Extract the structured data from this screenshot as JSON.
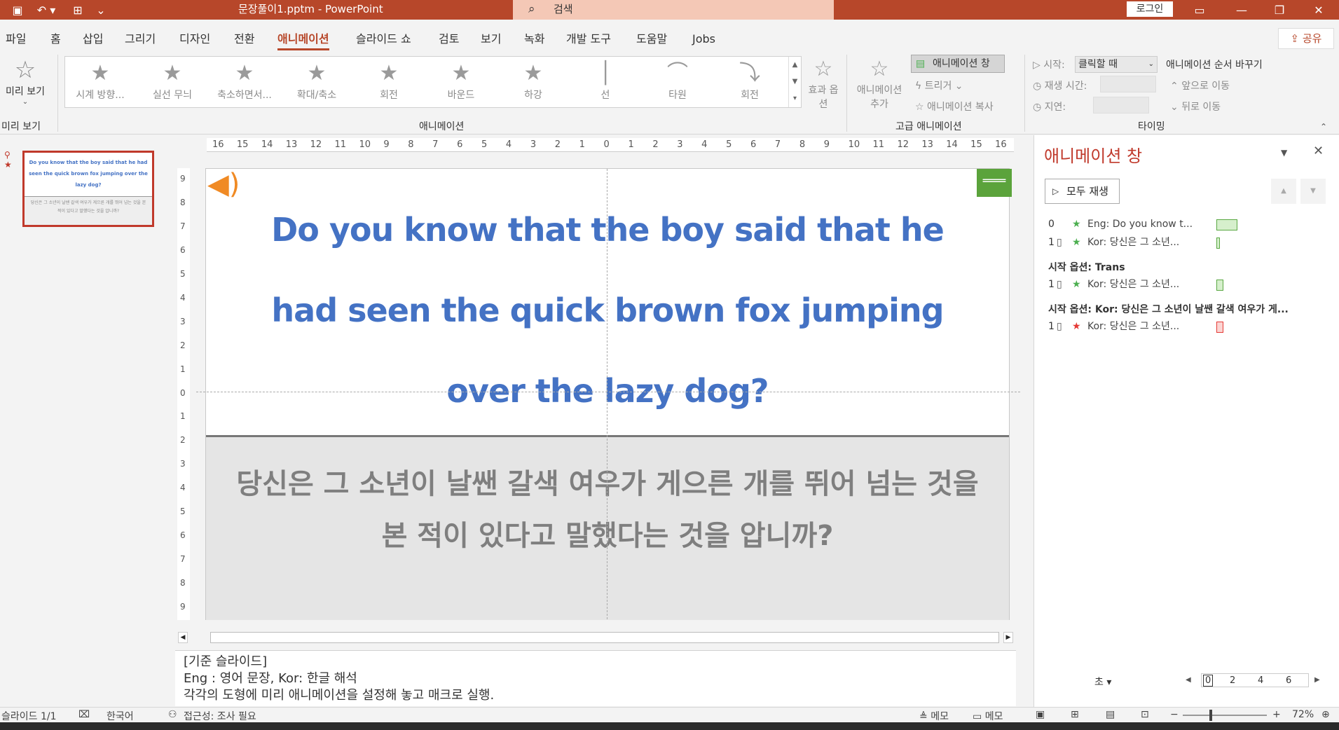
{
  "titlebar": {
    "doc_title": "문장풀이1.pptm  -  PowerPoint",
    "search_placeholder": "검색",
    "login": "로그인"
  },
  "tabs": [
    "파일",
    "홈",
    "삽입",
    "그리기",
    "디자인",
    "전환",
    "애니메이션",
    "슬라이드 쇼",
    "검토",
    "보기",
    "녹화",
    "개발 도구",
    "도움말",
    "Jobs"
  ],
  "active_tab": "애니메이션",
  "share": "공유",
  "ribbon": {
    "preview_label": "미리 보기",
    "preview_group": "미리 보기",
    "animations": [
      "시계 방향...",
      "실선 무늬",
      "축소하면서...",
      "확대/축소",
      "회전",
      "바운드",
      "하강",
      "선",
      "타원",
      "회전"
    ],
    "animation_group": "애니메이션",
    "effect_options": "효과 옵션",
    "add_animation": "애니메이션 추가",
    "animation_pane_btn": "애니메이션 창",
    "trigger": "트리거",
    "animation_copy": "애니메이션 복사",
    "advanced_group": "고급 애니메이션",
    "start_label": "시작:",
    "start_value": "클릭할 때",
    "duration_label": "재생 시간:",
    "delay_label": "지연:",
    "reorder_label": "애니메이션 순서 바꾸기",
    "move_earlier": "앞으로 이동",
    "move_later": "뒤로 이동",
    "timing_group": "타이밍"
  },
  "thumbnail": {
    "number": "1",
    "eng": "Do you know that the boy said that he had seen the quick brown fox jumping over the lazy dog?",
    "kor": "당신은 그 소년이 날쌘 갈색 여우가 게으른 개를 뛰어 넘는 것을 본 적이 있다고 말했다는 것을 압니까?"
  },
  "slide": {
    "eng": "Do you know that the boy said that he had seen the quick brown fox jumping over the lazy dog?",
    "kor": "당신은 그 소년이 날쌘 갈색 여우가 게으른 개를 뛰어 넘는 것을 본 적이 있다고 말했다는 것을 압니까?"
  },
  "notes": {
    "line1": "[기준 슬라이드]",
    "line2": "Eng : 영어 문장, Kor: 한글 해석",
    "line3": "각각의 도형에 미리 애니메이션을 설정해 놓고 매크로 실행."
  },
  "animpane": {
    "title": "애니메이션 창",
    "play_all": "모두 재생",
    "rows": [
      {
        "num": "0",
        "text": "Eng: Do you know t..."
      },
      {
        "num": "1",
        "text": "Kor: 당신은 그 소년..."
      }
    ],
    "section1": "시작 옵션: Trans",
    "row3": {
      "num": "1",
      "text": "Kor: 당신은 그 소년..."
    },
    "section2": "시작 옵션: Kor: 당신은 그 소년이 날쌘 갈색 여우가 게...",
    "row4": {
      "num": "1",
      "text": "Kor: 당신은 그 소년..."
    },
    "seconds_label": "초",
    "timeline": [
      "0",
      "2",
      "4",
      "6"
    ]
  },
  "status": {
    "slide": "슬라이드 1/1",
    "lang": "한국어",
    "access": "접근성: 조사 필요",
    "notes1": "메모",
    "notes2": "메모",
    "zoom": "72%"
  },
  "ruler_h": [
    "16",
    "15",
    "14",
    "13",
    "12",
    "11",
    "10",
    "9",
    "8",
    "7",
    "6",
    "5",
    "4",
    "3",
    "2",
    "1",
    "0",
    "1",
    "2",
    "3",
    "4",
    "5",
    "6",
    "7",
    "8",
    "9",
    "10",
    "11",
    "12",
    "13",
    "14",
    "15",
    "16"
  ],
  "ruler_v": [
    "9",
    "8",
    "7",
    "6",
    "5",
    "4",
    "3",
    "2",
    "1",
    "0",
    "1",
    "2",
    "3",
    "4",
    "5",
    "6",
    "7",
    "8",
    "9"
  ]
}
